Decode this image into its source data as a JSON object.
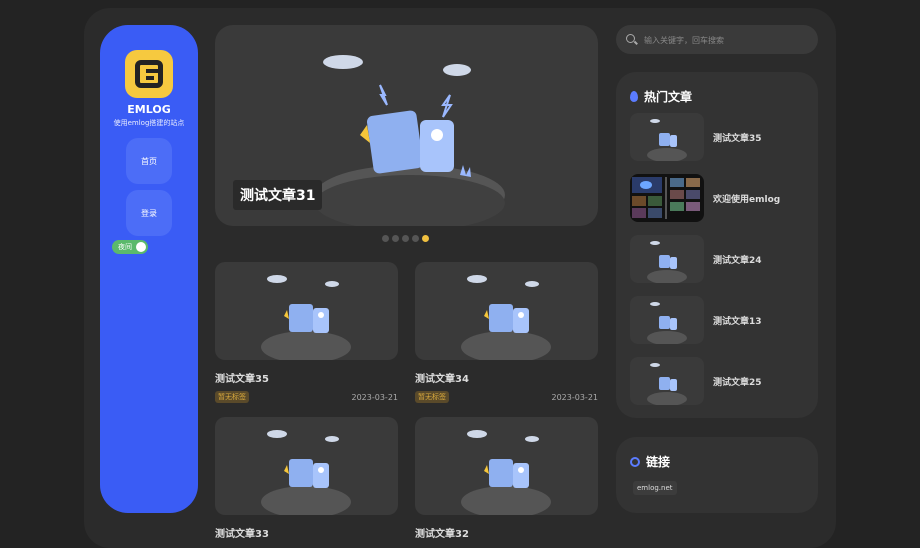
{
  "site": {
    "name": "EMLOG",
    "desc": "使用emlog搭建的站点"
  },
  "nav": {
    "home": "首页",
    "login": "登录",
    "night": "夜间"
  },
  "search": {
    "placeholder": "输入关键字，回车搜索"
  },
  "hero": {
    "title": "测试文章31"
  },
  "carousel": {
    "count": 5,
    "active_index": 4
  },
  "cards": [
    {
      "title": "测试文章35",
      "tag": "暂无标签",
      "date": "2023-03-21"
    },
    {
      "title": "测试文章34",
      "tag": "暂无标签",
      "date": "2023-03-21"
    },
    {
      "title": "测试文章33"
    },
    {
      "title": "测试文章32"
    }
  ],
  "hot": {
    "title": "热门文章",
    "items": [
      "测试文章35",
      "欢迎使用emlog",
      "测试文章24",
      "测试文章13",
      "测试文章25"
    ]
  },
  "links": {
    "title": "链接",
    "items": [
      "emlog.net"
    ]
  },
  "colors": {
    "sidebar": "#3a5cf5",
    "accent": "#5b7cff",
    "logo": "#f6c93f",
    "tag_bg": "#5a4a2a",
    "tag_text": "#d8a93d",
    "toggle": "#5bb96b"
  }
}
